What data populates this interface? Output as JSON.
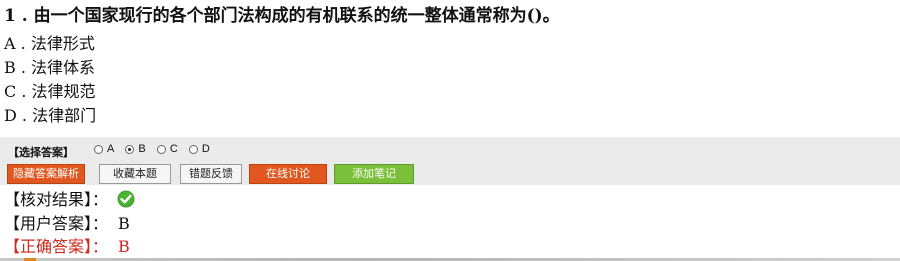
{
  "question": {
    "title": "1 . 由一个国家现行的各个部门法构成的有机联系的统一整体通常称为()。",
    "options": [
      {
        "letter": "A",
        "text": "A . 法律形式"
      },
      {
        "letter": "B",
        "text": "B . 法律体系"
      },
      {
        "letter": "C",
        "text": "C . 法律规范"
      },
      {
        "letter": "D",
        "text": "D . 法律部门"
      }
    ]
  },
  "answer_panel": {
    "label": "【选择答案】",
    "radios": [
      {
        "label": "A",
        "checked": false
      },
      {
        "label": "B",
        "checked": true
      },
      {
        "label": "C",
        "checked": false
      },
      {
        "label": "D",
        "checked": false
      }
    ],
    "buttons": {
      "hide": "隐藏答案解析",
      "favorite": "收藏本题",
      "feedback": "错题反馈",
      "discuss": "在线讨论",
      "note": "添加笔记"
    }
  },
  "result": {
    "check_label": "【核对结果】：",
    "check_icon": "green-checkmark-icon",
    "user_label": "【用户答案】：",
    "user_answer": "B",
    "correct_label": "【正确答案】：",
    "correct_answer": "B"
  },
  "colors": {
    "accent_orange": "#e2571f",
    "accent_green": "#7ac03a",
    "correct_red": "#d0281c",
    "panel_bg": "#ebebeb"
  }
}
